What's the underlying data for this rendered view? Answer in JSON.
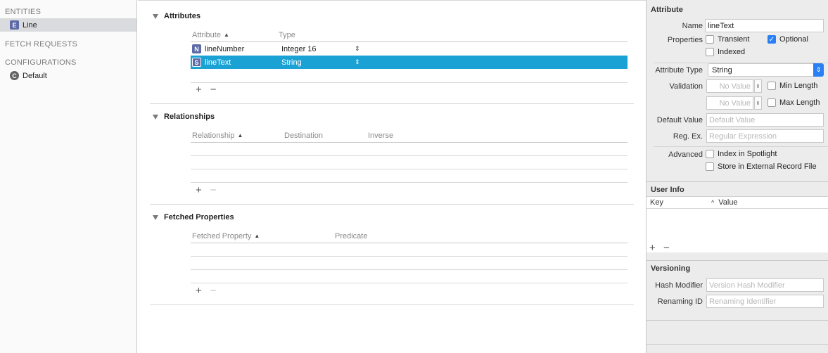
{
  "navigator": {
    "entities_header": "ENTITIES",
    "entities": [
      {
        "badge": "E",
        "label": "Line"
      }
    ],
    "fetch_header": "FETCH REQUESTS",
    "config_header": "CONFIGURATIONS",
    "configurations": [
      {
        "badge": "C",
        "label": "Default"
      }
    ]
  },
  "attributes": {
    "title": "Attributes",
    "columns": [
      "Attribute",
      "Type"
    ],
    "rows": [
      {
        "badge": "N",
        "name": "lineNumber",
        "type": "Integer 16",
        "selected": false
      },
      {
        "badge": "S",
        "name": "lineText",
        "type": "String",
        "selected": true
      }
    ],
    "add": "+",
    "remove": "−"
  },
  "relationships": {
    "title": "Relationships",
    "columns": [
      "Relationship",
      "Destination",
      "Inverse"
    ],
    "add": "+",
    "remove": "−"
  },
  "fetched": {
    "title": "Fetched Properties",
    "columns": [
      "Fetched Property",
      "Predicate"
    ],
    "add": "+",
    "remove": "−"
  },
  "inspector": {
    "attribute_title": "Attribute",
    "name_label": "Name",
    "name_value": "lineText",
    "properties_label": "Properties",
    "transient": {
      "label": "Transient",
      "checked": false
    },
    "optional": {
      "label": "Optional",
      "checked": true
    },
    "indexed": {
      "label": "Indexed",
      "checked": false
    },
    "attr_type_label": "Attribute Type",
    "attr_type_value": "String",
    "validation_label": "Validation",
    "min_value_placeholder": "No Value",
    "max_value_placeholder": "No Value",
    "min_length": {
      "label": "Min Length",
      "checked": false
    },
    "max_length": {
      "label": "Max Length",
      "checked": false
    },
    "default_label": "Default Value",
    "default_placeholder": "Default Value",
    "regex_label": "Reg. Ex.",
    "regex_placeholder": "Regular Expression",
    "advanced_label": "Advanced",
    "spotlight": {
      "label": "Index in Spotlight",
      "checked": false
    },
    "external": {
      "label": "Store in External Record File",
      "checked": false
    },
    "userinfo_title": "User Info",
    "userinfo_key": "Key",
    "userinfo_value": "Value",
    "userinfo_add": "+",
    "userinfo_remove": "−",
    "versioning_title": "Versioning",
    "hash_label": "Hash Modifier",
    "hash_placeholder": "Version Hash Modifier",
    "renaming_label": "Renaming ID",
    "renaming_placeholder": "Renaming Identifier"
  },
  "colors": {
    "selection": "#1aa2d4",
    "accent": "#2b7ff4",
    "badge": "#5d6aa6"
  }
}
